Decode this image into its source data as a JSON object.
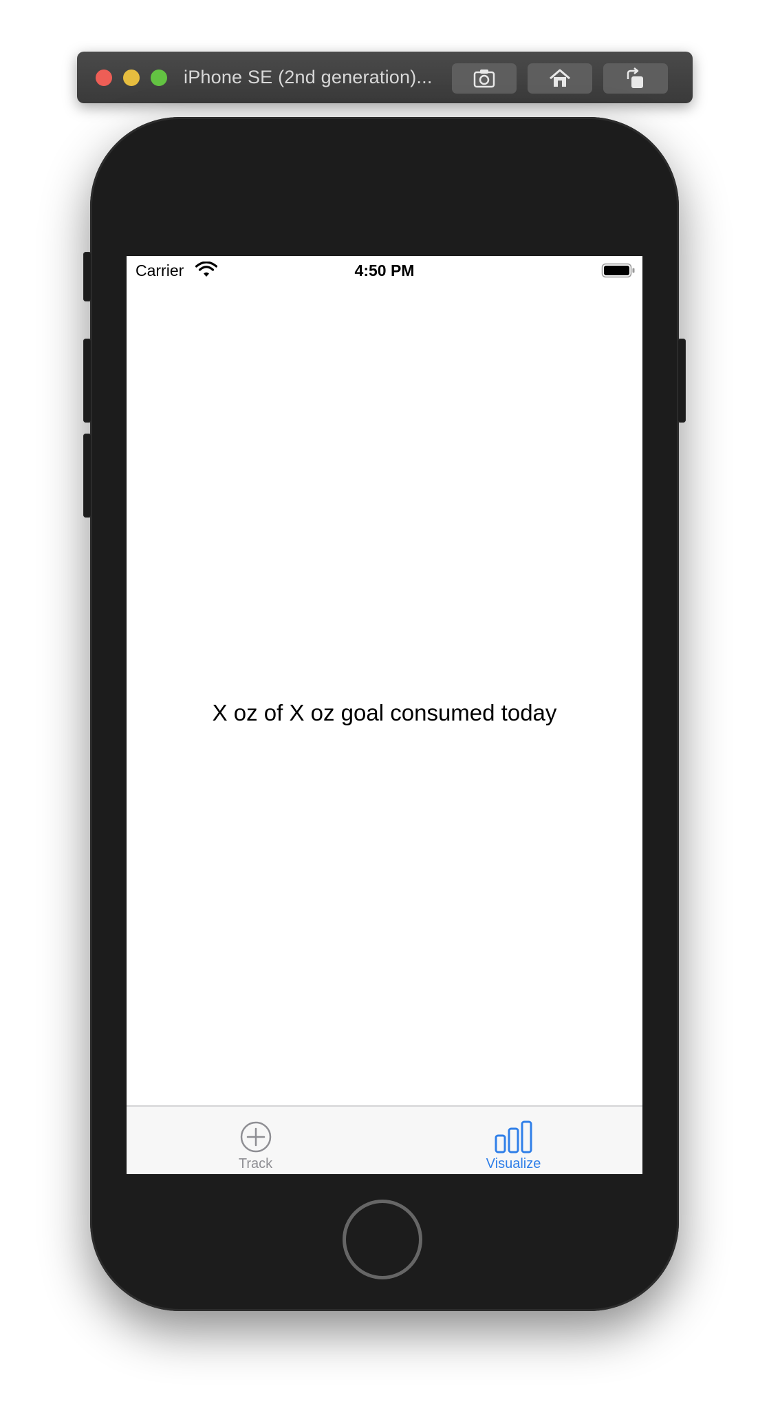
{
  "window": {
    "title": "iPhone SE (2nd generation)...",
    "toolbar": {
      "screenshot_icon": "camera-icon",
      "home_icon": "home-icon",
      "rotate_icon": "rotate-icon"
    }
  },
  "status_bar": {
    "carrier": "Carrier",
    "time": "4:50 PM",
    "wifi_icon": "wifi-icon",
    "battery_icon": "battery-icon"
  },
  "main": {
    "summary_text": "X oz of X oz goal consumed today"
  },
  "tab_bar": {
    "tabs": [
      {
        "label": "Track",
        "icon": "plus-circle-icon",
        "selected": false
      },
      {
        "label": "Visualize",
        "icon": "bar-chart-icon",
        "selected": true
      }
    ],
    "active_color": "#2f7fe8",
    "inactive_color": "#8e8e93"
  }
}
